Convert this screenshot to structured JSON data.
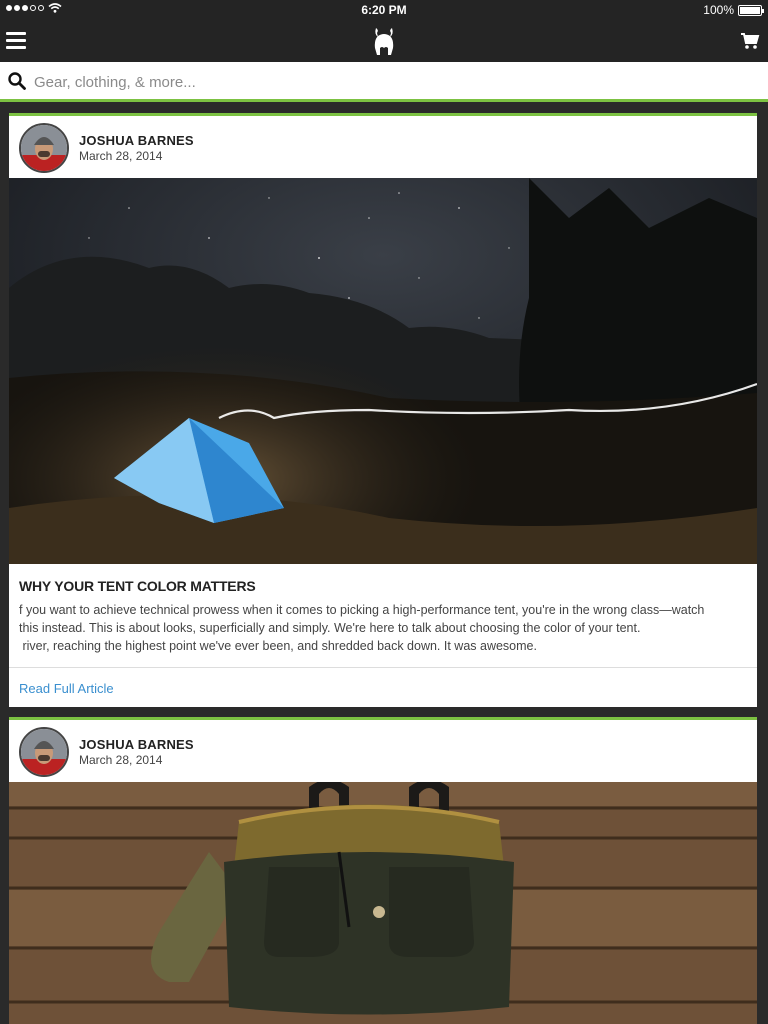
{
  "status_bar": {
    "time": "6:20 PM",
    "battery": "100%"
  },
  "nav": {
    "menu_icon": "hamburger-icon",
    "logo_icon": "goat-logo-icon",
    "cart_icon": "cart-icon"
  },
  "search": {
    "placeholder": "Gear, clothing, & more...",
    "icon": "search-icon"
  },
  "accent_color": "#7cc242",
  "link_color": "#3a8fcf",
  "articles": [
    {
      "author": "JOSHUA BARNES",
      "date": "March 28, 2014",
      "title": "WHY YOUR TENT COLOR MATTERS",
      "body_lines": [
        "f you want to achieve technical prowess when it comes to picking a high-performance tent, you're in the wrong class—watch",
        "this instead. This is about looks, superficially and simply. We're here to talk about choosing the color of your tent.",
        " river, reaching the highest point we've ever been, and shredded back down. It was awesome."
      ],
      "link": "Read Full Article"
    },
    {
      "author": "JOSHUA BARNES",
      "date": "March 28, 2014"
    }
  ]
}
